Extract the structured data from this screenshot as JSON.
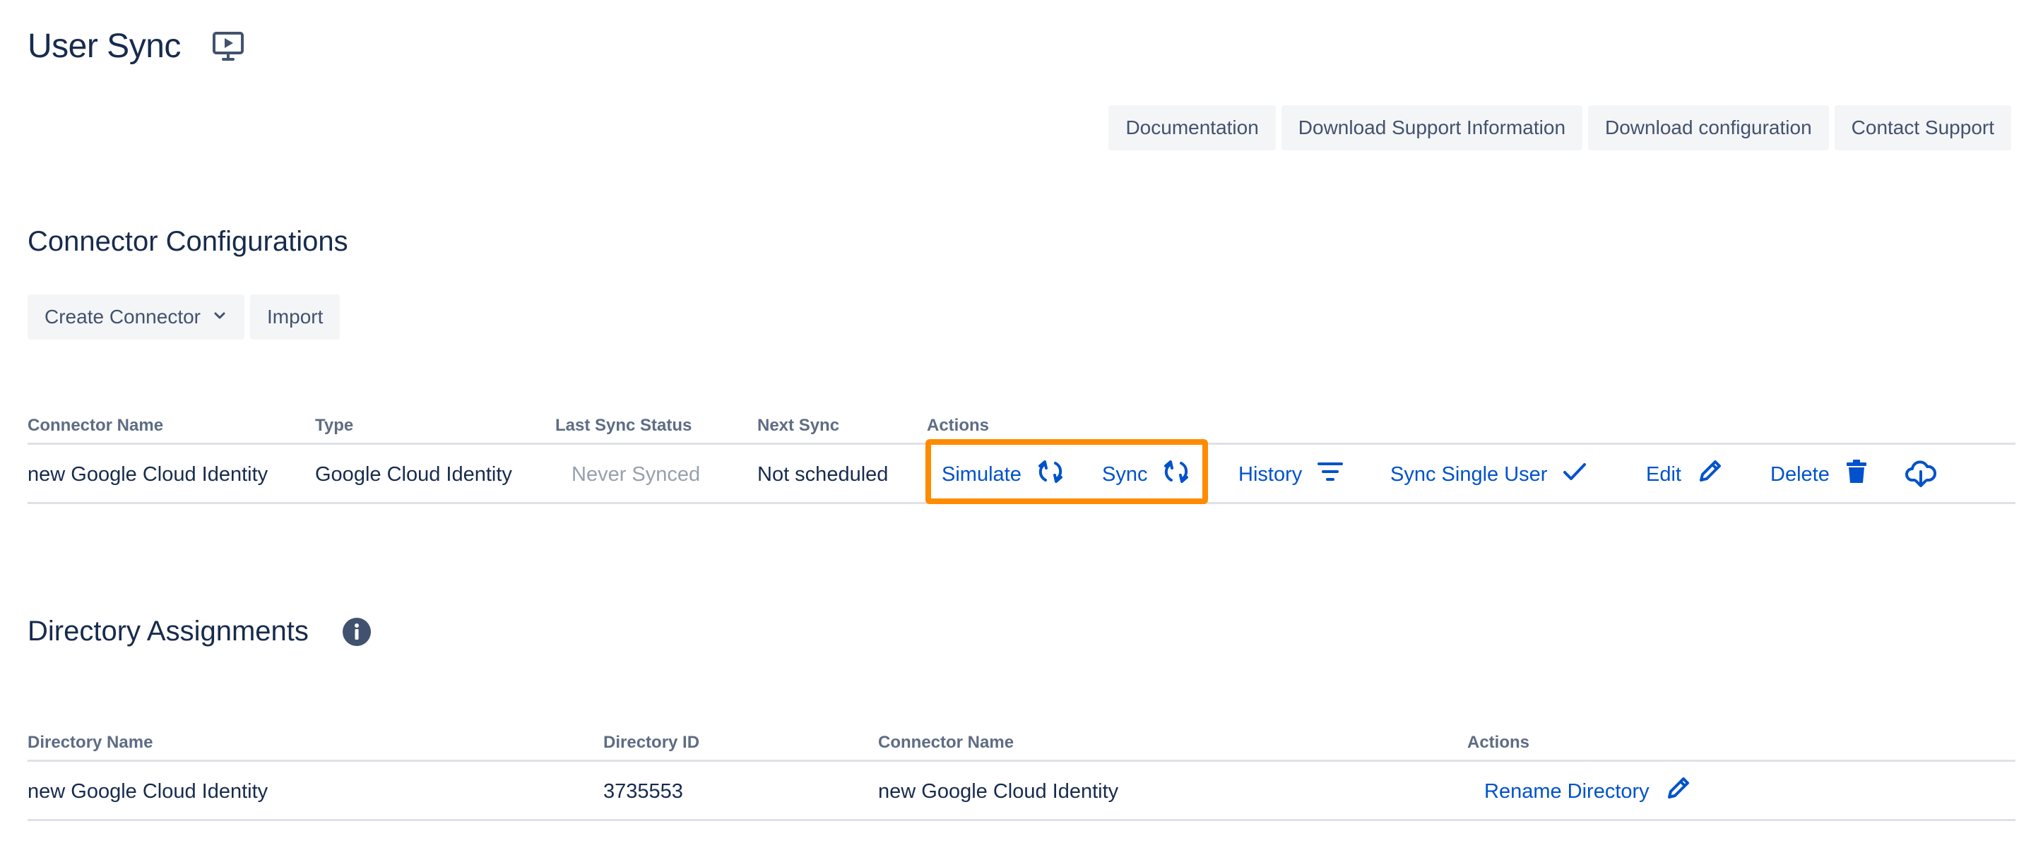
{
  "header": {
    "title": "User Sync",
    "title_icon": "presentation-icon"
  },
  "top_buttons": {
    "documentation": "Documentation",
    "download_support": "Download Support Information",
    "download_config": "Download configuration",
    "contact_support": "Contact Support"
  },
  "connectors": {
    "title": "Connector Configurations",
    "create_label": "Create Connector",
    "import_label": "Import",
    "columns": {
      "name": "Connector Name",
      "type": "Type",
      "last_sync": "Last Sync Status",
      "next_sync": "Next Sync",
      "actions": "Actions"
    },
    "rows": [
      {
        "name": "new Google Cloud Identity",
        "type": "Google Cloud Identity",
        "last_sync": "Never Synced",
        "next_sync": "Not scheduled"
      }
    ],
    "actions": {
      "simulate": "Simulate",
      "sync": "Sync",
      "history": "History",
      "sync_single_user": "Sync Single User",
      "edit": "Edit",
      "delete": "Delete"
    }
  },
  "directories": {
    "title": "Directory Assignments",
    "columns": {
      "name": "Directory Name",
      "id": "Directory ID",
      "connector": "Connector Name",
      "actions": "Actions"
    },
    "rows": [
      {
        "name": "new Google Cloud Identity",
        "id": "3735553",
        "connector": "new Google Cloud Identity"
      }
    ],
    "actions": {
      "rename": "Rename Directory"
    }
  },
  "colors": {
    "link": "#0052cc",
    "highlight": "#ff8b00",
    "text": "#172b4d",
    "muted": "#97a0af"
  }
}
